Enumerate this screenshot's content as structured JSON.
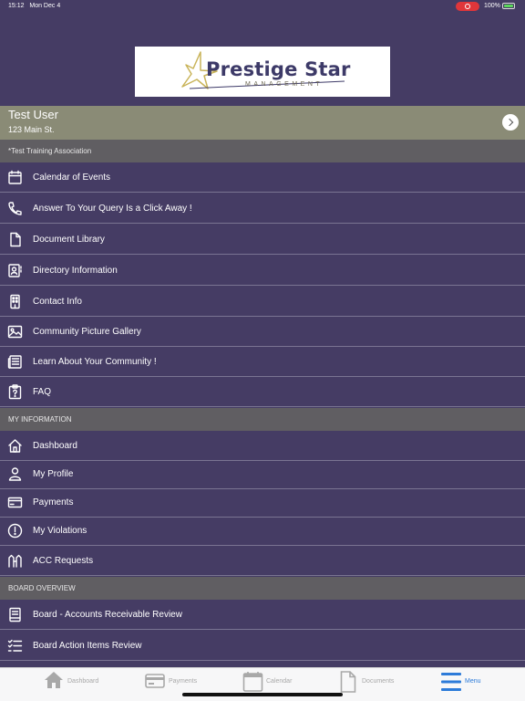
{
  "status": {
    "time": "15:12",
    "date": "Mon Dec 4",
    "battery": "100%"
  },
  "logo": {
    "title": "Prestige Star",
    "subtitle": "MANAGEMENT"
  },
  "user": {
    "name": "Test User",
    "address": "123 Main St."
  },
  "association": {
    "label": "*Test Training Association"
  },
  "menu": [
    {
      "label": "Calendar of Events",
      "icon": "calendar-icon"
    },
    {
      "label": "Answer To Your Query Is a Click Away !",
      "icon": "phone-icon"
    },
    {
      "label": "Document Library",
      "icon": "document-icon"
    },
    {
      "label": "Directory Information",
      "icon": "contact-card-icon"
    },
    {
      "label": "Contact Info",
      "icon": "building-icon"
    },
    {
      "label": "Community Picture Gallery",
      "icon": "image-icon"
    },
    {
      "label": "Learn About Your Community !",
      "icon": "newspaper-icon"
    },
    {
      "label": "FAQ",
      "icon": "faq-clipboard-icon"
    }
  ],
  "my_information": {
    "header": "MY INFORMATION",
    "items": [
      {
        "label": "Dashboard",
        "icon": "home-icon"
      },
      {
        "label": "My Profile",
        "icon": "person-icon"
      },
      {
        "label": "Payments",
        "icon": "credit-card-icon"
      },
      {
        "label": "My Violations",
        "icon": "alert-circle-icon"
      },
      {
        "label": "ACC Requests",
        "icon": "acc-request-icon"
      }
    ]
  },
  "board_overview": {
    "header": "BOARD OVERVIEW",
    "items": [
      {
        "label": "Board - Accounts Receivable Review",
        "icon": "ledger-book-icon"
      },
      {
        "label": "Board Action Items Review",
        "icon": "checklist-icon"
      }
    ]
  },
  "tabs": [
    {
      "label": "Dashboard",
      "icon": "home-icon",
      "active": false
    },
    {
      "label": "Payments",
      "icon": "credit-card-icon",
      "active": false
    },
    {
      "label": "Calendar",
      "icon": "calendar-icon",
      "active": false
    },
    {
      "label": "Documents",
      "icon": "document-icon",
      "active": false
    },
    {
      "label": "Menu",
      "icon": "hamburger-menu-icon",
      "active": true
    }
  ],
  "colors": {
    "background": "#453c64",
    "header_band": "#8a8b76",
    "section_band": "#605e62",
    "logo_text": "#3d3a68",
    "tab_active": "#2d7bd9",
    "tab_inactive": "#a8a8a8"
  }
}
